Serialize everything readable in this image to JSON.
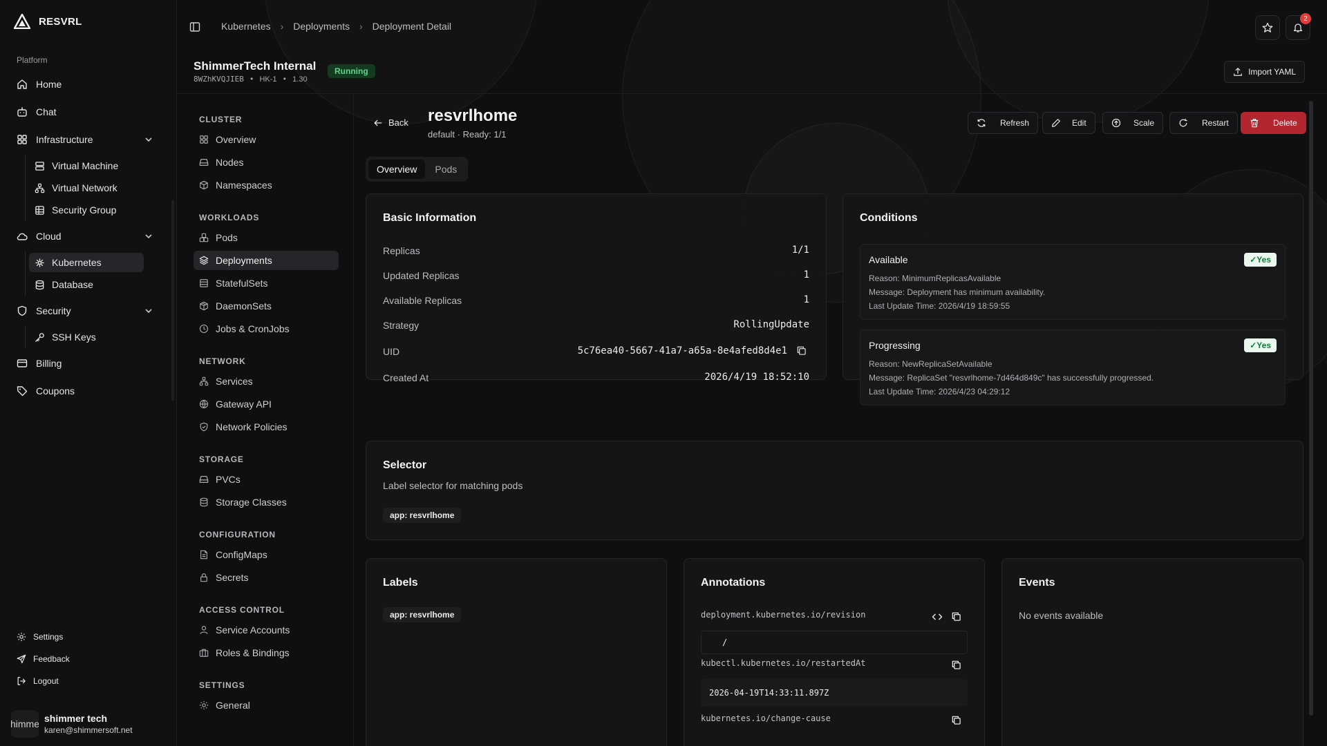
{
  "brand": {
    "name": "RESVRL"
  },
  "sidebar": {
    "section_label": "Platform",
    "items": {
      "home": "Home",
      "chat": "Chat",
      "infrastructure": "Infrastructure",
      "virtual_machine": "Virtual Machine",
      "virtual_network": "Virtual Network",
      "security_group": "Security Group",
      "cloud": "Cloud",
      "kubernetes": "Kubernetes",
      "database": "Database",
      "security": "Security",
      "ssh_keys": "SSH Keys",
      "billing": "Billing",
      "coupons": "Coupons"
    },
    "footer": {
      "settings": "Settings",
      "feedback": "Feedback",
      "logout": "Logout"
    },
    "user": {
      "avatar_text": "himme",
      "name": "shimmer tech",
      "email": "karen@shimmersoft.net"
    }
  },
  "breadcrumb": [
    "Kubernetes",
    "Deployments",
    "Deployment Detail"
  ],
  "notifications": {
    "count": "2"
  },
  "cluster": {
    "name": "ShimmerTech Internal",
    "status": "Running",
    "id": "8WZhKVQJIEB",
    "region": "HK-1",
    "version": "1.30",
    "import_label": "Import YAML"
  },
  "subnav": {
    "cluster": {
      "heading": "CLUSTER",
      "items": [
        "Overview",
        "Nodes",
        "Namespaces"
      ]
    },
    "workloads": {
      "heading": "WORKLOADS",
      "items": [
        "Pods",
        "Deployments",
        "StatefulSets",
        "DaemonSets",
        "Jobs & CronJobs"
      ]
    },
    "network": {
      "heading": "NETWORK",
      "items": [
        "Services",
        "Gateway API",
        "Network Policies"
      ]
    },
    "storage": {
      "heading": "STORAGE",
      "items": [
        "PVCs",
        "Storage Classes"
      ]
    },
    "configuration": {
      "heading": "CONFIGURATION",
      "items": [
        "ConfigMaps",
        "Secrets"
      ]
    },
    "access": {
      "heading": "ACCESS CONTROL",
      "items": [
        "Service Accounts",
        "Roles & Bindings"
      ]
    },
    "settings": {
      "heading": "SETTINGS",
      "items": [
        "General"
      ]
    }
  },
  "deployment": {
    "back_label": "Back",
    "name": "resvrlhome",
    "subtitle": "default · Ready: 1/1",
    "actions": {
      "refresh": "Refresh",
      "edit": "Edit",
      "scale": "Scale",
      "restart": "Restart",
      "delete": "Delete"
    },
    "tabs": [
      "Overview",
      "Pods"
    ],
    "basic": {
      "title": "Basic Information",
      "rows": [
        {
          "label": "Replicas",
          "value": "1/1"
        },
        {
          "label": "Updated Replicas",
          "value": "1"
        },
        {
          "label": "Available Replicas",
          "value": "1"
        },
        {
          "label": "Strategy",
          "value": "RollingUpdate"
        },
        {
          "label": "UID",
          "value": "5c76ea40-5667-41a7-a65a-8e4afed8d4e1"
        },
        {
          "label": "Created At",
          "value": "2026/4/19 18:52:10"
        }
      ]
    },
    "conditions": {
      "title": "Conditions",
      "items": [
        {
          "type": "Available",
          "status": "✓Yes",
          "reason": "Reason: MinimumReplicasAvailable",
          "message": "Message: Deployment has minimum availability.",
          "time": "Last Update Time: 2026/4/19 18:59:55"
        },
        {
          "type": "Progressing",
          "status": "✓Yes",
          "reason": "Reason: NewReplicaSetAvailable",
          "message": "Message: ReplicaSet \"resvrlhome-7d464d849c\" has successfully progressed.",
          "time": "Last Update Time: 2026/4/23 04:29:12"
        }
      ]
    },
    "selector": {
      "title": "Selector",
      "description": "Label selector for matching pods",
      "chip": "app: resvrlhome"
    },
    "labels": {
      "title": "Labels",
      "chip": "app: resvrlhome"
    },
    "annotations": {
      "title": "Annotations",
      "items": [
        {
          "key": "deployment.kubernetes.io/revision",
          "value": "/"
        },
        {
          "key": "kubectl.kubernetes.io/restartedAt",
          "value": "2026-04-19T14:33:11.897Z"
        },
        {
          "key": "kubernetes.io/change-cause",
          "value": ""
        }
      ]
    },
    "events": {
      "title": "Events",
      "empty": "No events available"
    }
  },
  "colors": {
    "accent_running": "#5fd38a",
    "danger": "#b32630",
    "badge": "#e23d3d"
  }
}
